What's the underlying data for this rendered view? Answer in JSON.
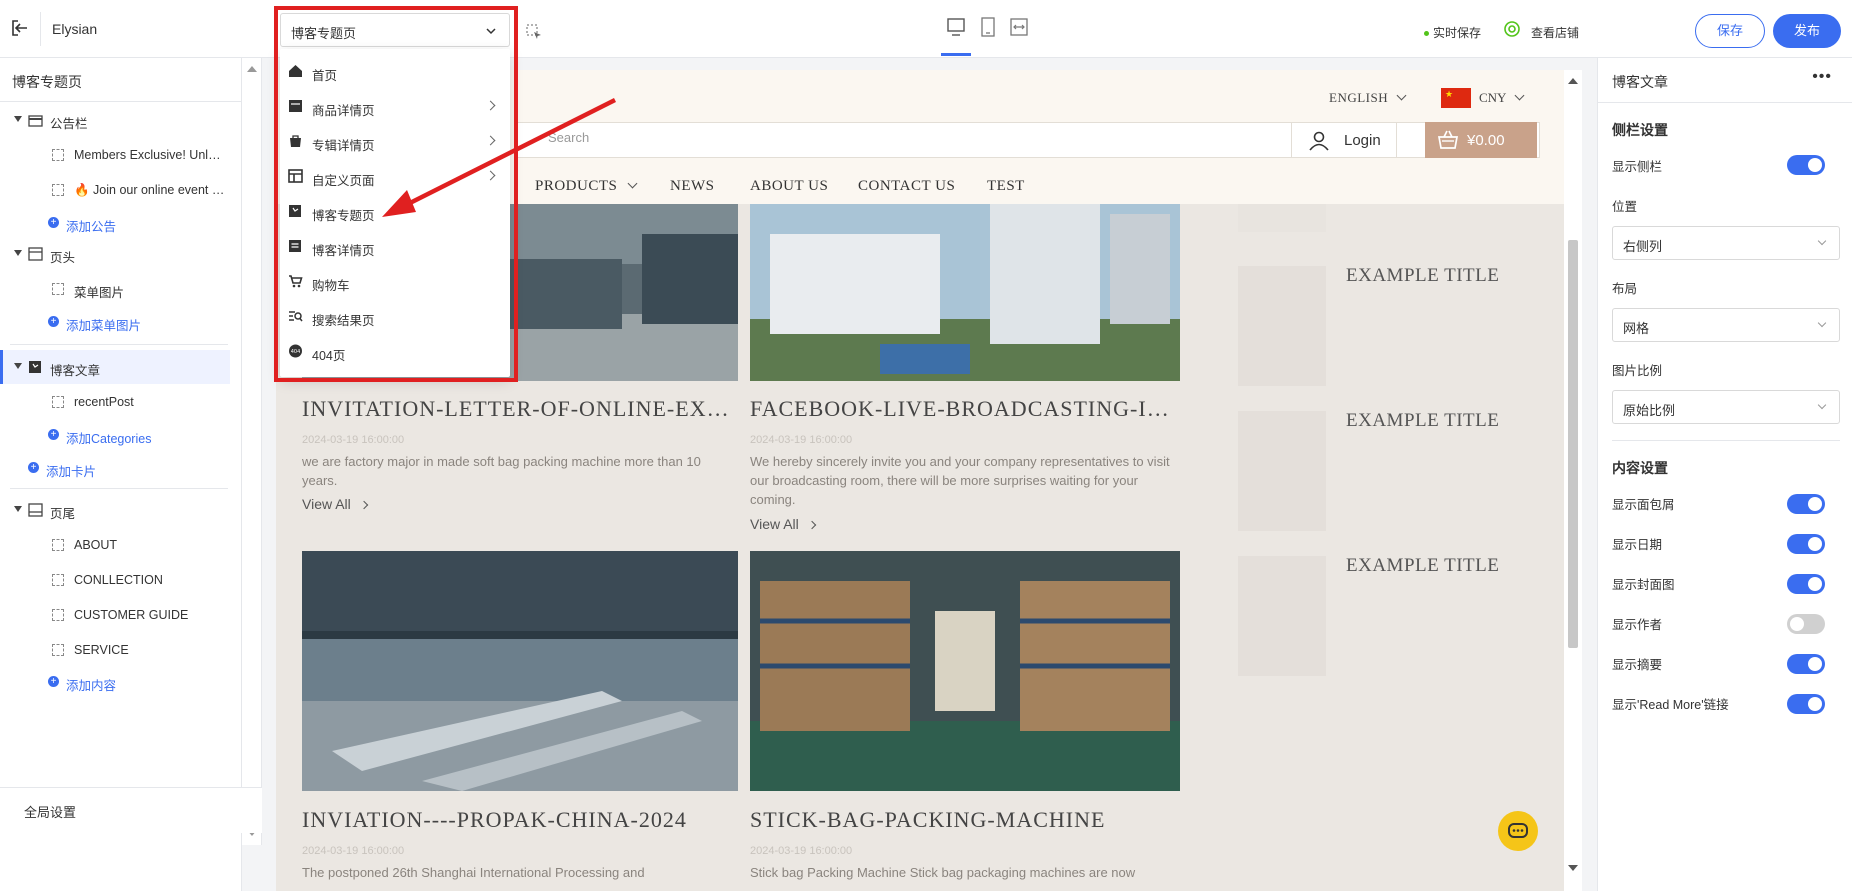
{
  "app": {
    "store_name": "Elysian",
    "selected_page": "博客专题页",
    "autosave_label": "实时保存",
    "view_store_label": "查看店铺",
    "save_label": "保存",
    "publish_label": "发布"
  },
  "page_menu": {
    "items": [
      {
        "label": "首页",
        "icon": "home-icon",
        "has_submenu": false
      },
      {
        "label": "商品详情页",
        "icon": "product-icon",
        "has_submenu": true
      },
      {
        "label": "专辑详情页",
        "icon": "collection-icon",
        "has_submenu": true
      },
      {
        "label": "自定义页面",
        "icon": "layout-icon",
        "has_submenu": true
      },
      {
        "label": "博客专题页",
        "icon": "blog-icon",
        "has_submenu": false
      },
      {
        "label": "博客详情页",
        "icon": "article-icon",
        "has_submenu": false
      },
      {
        "label": "购物车",
        "icon": "cart-icon",
        "has_submenu": false
      },
      {
        "label": "搜索结果页",
        "icon": "search-list-icon",
        "has_submenu": false
      },
      {
        "label": "404页",
        "icon": "error-404-icon",
        "has_submenu": false
      }
    ]
  },
  "left": {
    "title": "博客专题页",
    "announcement": {
      "label": "公告栏",
      "children": [
        "Members Exclusive! Unlock Special Offers",
        "🔥 Join our online event on Facebook"
      ],
      "add_label": "添加公告"
    },
    "header": {
      "label": "页头",
      "children": [
        "菜单图片"
      ],
      "add_label": "添加菜单图片"
    },
    "blog": {
      "label": "博客文章",
      "children": [
        "recentPost"
      ],
      "add_label": "添加Categories"
    },
    "add_card_label": "添加卡片",
    "footer": {
      "label": "页尾",
      "children": [
        "ABOUT",
        "CONLLECTION",
        "CUSTOMER GUIDE",
        "SERVICE"
      ],
      "add_label": "添加内容"
    },
    "global_settings_label": "全局设置"
  },
  "preview": {
    "language": "ENGLISH",
    "currency": "CNY",
    "search_placeholder": "Search",
    "login_label": "Login",
    "cart_total": "¥0.00",
    "nav": [
      "PRODUCTS",
      "NEWS",
      "ABOUT US",
      "CONTACT US",
      "TEST"
    ],
    "posts": [
      {
        "title": "INVITATION-LETTER-OF-ONLINE-EXHIBITION",
        "date": "2024-03-19 16:00:00",
        "excerpt": "we are factory major in made soft bag packing machine more than 10 years.",
        "view_all": "View All"
      },
      {
        "title": "FACEBOOK-LIVE-BROADCASTING-INVITATION",
        "date": "2024-03-19 16:00:00",
        "excerpt": "We hereby sincerely invite you and your company representatives to visit our broadcasting room, there will be more surprises waiting for your coming.",
        "view_all": "View All"
      },
      {
        "title": "INVIATION----PROPAK-CHINA-2024",
        "date": "2024-03-19 16:00:00",
        "excerpt": "The postponed 26th Shanghai International Processing and",
        "view_all": ""
      },
      {
        "title": "STICK-BAG-PACKING-MACHINE",
        "date": "2024-03-19 16:00:00",
        "excerpt": "Stick bag Packing Machine Stick bag packaging machines are now",
        "view_all": ""
      }
    ],
    "sidebar_titles": [
      "EXAMPLE TITLE",
      "EXAMPLE TITLE",
      "EXAMPLE TITLE"
    ]
  },
  "right": {
    "title": "博客文章",
    "sidebar_section": "侧栏设置",
    "show_sidebar": {
      "label": "显示侧栏",
      "on": true
    },
    "position": {
      "label": "位置",
      "value": "右侧列"
    },
    "layout": {
      "label": "布局",
      "value": "网格"
    },
    "ratio": {
      "label": "图片比例",
      "value": "原始比例"
    },
    "content_section": "内容设置",
    "toggles": [
      {
        "label": "显示面包屑",
        "on": true
      },
      {
        "label": "显示日期",
        "on": true
      },
      {
        "label": "显示封面图",
        "on": true
      },
      {
        "label": "显示作者",
        "on": false
      },
      {
        "label": "显示摘要",
        "on": true
      },
      {
        "label": "显示'Read More'链接",
        "on": true
      }
    ]
  },
  "colors": {
    "accent": "#3a6df0",
    "cart_button": "#c9a28a",
    "highlight": "#e02020"
  }
}
